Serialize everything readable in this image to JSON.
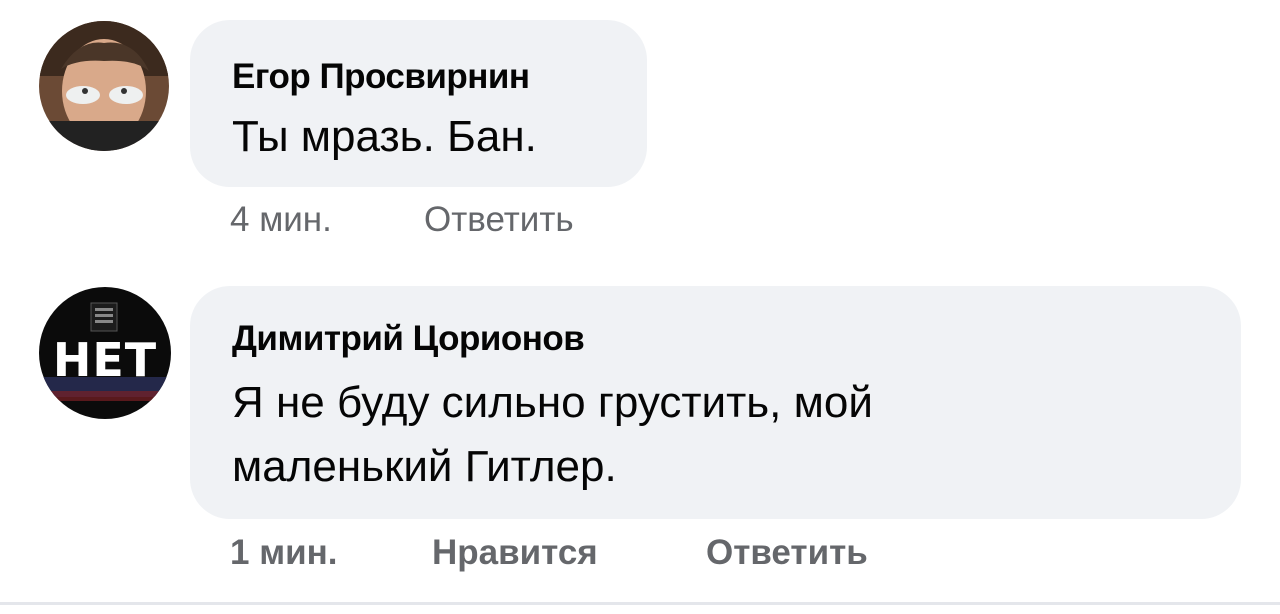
{
  "comments": [
    {
      "author": "Егор Просвирнин",
      "text_lines": [
        "Ты мразь. Бан."
      ],
      "time": "4 мин.",
      "reply_label": "Ответить",
      "avatar_icon": "user-photo-avatar"
    },
    {
      "author": "Димитрий Цорионов",
      "text_lines": [
        "Я не буду сильно грустить, мой",
        "маленький Гитлер."
      ],
      "time": "1 мин.",
      "like_label": "Нравится",
      "reply_label": "Ответить",
      "avatar_icon": "net-logo-avatar",
      "avatar_text": "НЕТ"
    }
  ],
  "colors": {
    "bubble": "#f0f2f5",
    "meta_text": "#65676b",
    "author_text": "#050505"
  }
}
